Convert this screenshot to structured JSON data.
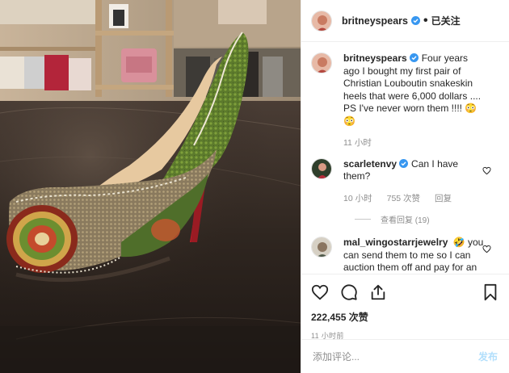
{
  "post": {
    "username": "britneyspears",
    "follow_status": "已关注",
    "likes": "222,455 次赞",
    "timestamp": "11 小时前"
  },
  "comments": [
    {
      "username": "britneyspears",
      "text": "Four years ago I bought my first pair of Christian Louboutin snakeskin heels that were 6,000 dollars .... PS I've never worn them !!!! 😳😳",
      "time": "11 小时"
    },
    {
      "username": "scarletenvy",
      "text": "Can I have them?",
      "time": "10 小时",
      "likes": "755 次赞",
      "reply": "回复",
      "view_replies": "查看回复 (19)"
    },
    {
      "username": "mal_wingostarrjewelry",
      "text": "🤣 you can send them to me so I can auction them off and pay for an entire years worth of meals for all the people that go without food in my town 🤹💕"
    }
  ],
  "add_comment": {
    "placeholder": "添加评论...",
    "post_label": "发布"
  },
  "icons": [
    "verified-badge-icon",
    "heart-icon",
    "comment-icon",
    "share-icon",
    "bookmark-icon"
  ],
  "colors": {
    "verified": "#3897f0",
    "post_disabled": "#b2dffc",
    "meta": "#8e8e8e",
    "text": "#262626"
  }
}
